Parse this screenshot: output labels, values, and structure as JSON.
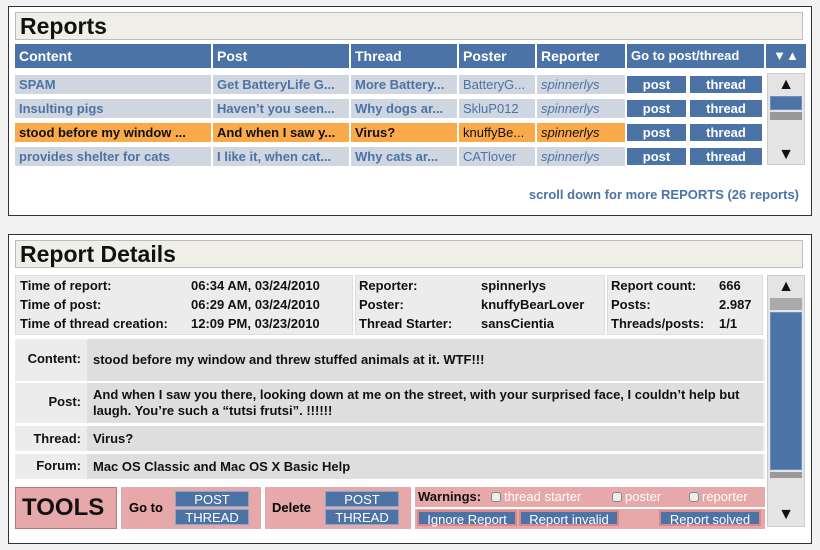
{
  "reports": {
    "title": "Reports",
    "columns": [
      "Content",
      "Post",
      "Thread",
      "Poster",
      "Reporter",
      "Go to post/thread"
    ],
    "sort_icons": "▼▲",
    "rows": [
      {
        "content": "SPAM",
        "post": "Get BatteryLife G...",
        "thread": "More Battery...",
        "poster": "BatteryG...",
        "reporter": "spinnerlys",
        "btn_post": "post",
        "btn_thread": "thread",
        "selected": false
      },
      {
        "content": "Insulting pigs",
        "post": "Haven’t you seen...",
        "thread": "Why dogs ar...",
        "poster": "SkluP012",
        "reporter": "spinnerlys",
        "btn_post": "post",
        "btn_thread": "thread",
        "selected": false
      },
      {
        "content": "stood before my window ...",
        "post": "And when I saw y...",
        "thread": "Virus?",
        "poster": "knuffyBe...",
        "reporter": "spinnerlys",
        "btn_post": "post",
        "btn_thread": "thread",
        "selected": true
      },
      {
        "content": "provides shelter for cats",
        "post": "I like it, when cat...",
        "thread": "Why cats ar...",
        "poster": "CATlover",
        "reporter": "spinnerlys",
        "btn_post": "post",
        "btn_thread": "thread",
        "selected": false
      }
    ],
    "more_text": "scroll down for more REPORTS (26 reports)"
  },
  "details": {
    "title": "Report Details",
    "info": {
      "time_of_report_label": "Time of report:",
      "time_of_report": "06:34 AM, 03/24/2010",
      "time_of_post_label": "Time of post:",
      "time_of_post": "06:29 AM, 03/24/2010",
      "time_of_thread_label": "Time of thread creation:",
      "time_of_thread": "12:09 PM, 03/23/2010",
      "reporter_label": "Reporter:",
      "reporter": "spinnerlys",
      "poster_label": "Poster:",
      "poster": "knuffyBearLover",
      "starter_label": "Thread Starter:",
      "starter": "sansCientia",
      "report_count_label": "Report count:",
      "report_count": "666",
      "posts_label": "Posts:",
      "posts": "2.987",
      "threads_posts_label": "Threads/posts:",
      "threads_posts": "1/1"
    },
    "fields": {
      "content_label": "Content:",
      "content": "stood before my window and threw  stuffed animals at it. WTF!!!",
      "post_label": "Post:",
      "post": "And when I saw you there, looking down at me on the street, with your surprised face, I couldn’t help but laugh. You’re such a “tutsi frutsi”. !!!!!!",
      "thread_label": "Thread:",
      "thread": "Virus?",
      "forum_label": "Forum:",
      "forum": "Mac OS Classic and Mac OS X Basic Help"
    },
    "tools": {
      "title": "TOOLS",
      "goto_label": "Go to",
      "goto_post": "POST",
      "goto_thread": "THREAD",
      "delete_label": "Delete",
      "delete_post": "POST",
      "delete_thread": "THREAD",
      "warnings_label": "Warnings:",
      "warn_thread_starter": "thread starter",
      "warn_poster": "poster",
      "warn_reporter": "reporter",
      "ignore": "Ignore Report",
      "invalid": "Report invalid",
      "solved": "Report solved"
    }
  },
  "colors": {
    "accent": "#4b73a6",
    "selected": "#fbaa4b",
    "tools": "#e6a8a8"
  }
}
